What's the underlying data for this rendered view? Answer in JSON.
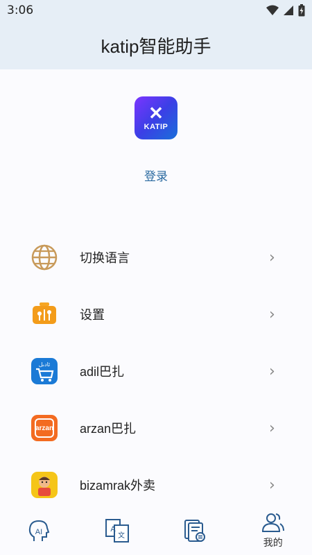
{
  "status": {
    "time": "3:06"
  },
  "header": {
    "title": "katip智能助手"
  },
  "profile": {
    "logo_text": "KATIP",
    "login_label": "登录"
  },
  "menu": {
    "items": [
      {
        "label": "切换语言",
        "icon": "globe-icon"
      },
      {
        "label": "设置",
        "icon": "settings-icon"
      },
      {
        "label": "adil巴扎",
        "icon": "adil-app-icon"
      },
      {
        "label": "arzan巴扎",
        "icon": "arzan-app-icon"
      },
      {
        "label": "bizamrak外卖",
        "icon": "bizamrak-app-icon"
      }
    ],
    "chevron": "›"
  },
  "adil_icon_text": "ﺋﺎدﯨﻞ",
  "arzan_icon_text": "arzan",
  "tabs": [
    {
      "icon": "ai-head-icon",
      "label": ""
    },
    {
      "icon": "translate-icon",
      "label": ""
    },
    {
      "icon": "document-icon",
      "label": ""
    },
    {
      "icon": "users-icon",
      "label": "我的"
    }
  ],
  "colors": {
    "header_bg": "#e6eef6",
    "link": "#2b6aa0",
    "accent": "#2a5b8f"
  }
}
